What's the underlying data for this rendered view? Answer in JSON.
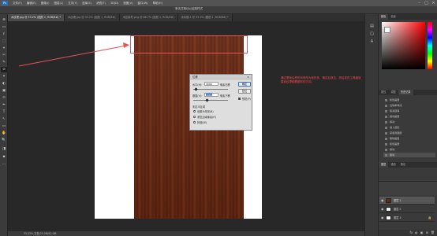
{
  "menubar": {
    "logo": "Ps",
    "items": [
      "文件(F)",
      "编辑(E)",
      "图像(I)",
      "图层(L)",
      "文字(Y)",
      "选择(S)",
      "滤镜(T)",
      "3D(D)",
      "视图(V)",
      "窗口(W)",
      "帮助(H)"
    ],
    "window_controls": [
      "–",
      "□",
      "×"
    ]
  },
  "optbar": {
    "title": "单击并拖动以绘制样式"
  },
  "tabs": [
    {
      "label": "木纹理.jpg @ 33.2% (图层 1, RGB/8#) *",
      "active": true
    },
    {
      "label": "木纹理.jpg @ 33.2% (图层 1, RGB/8#)"
    },
    {
      "label": "木纹素材.png @ 66.7% (图层 1, RGB/8#)"
    },
    {
      "label": "未标题-1 @ 33.3% (图层 1, RGB/8#) *"
    }
  ],
  "tools": [
    "⊕",
    "▭",
    "ℓ",
    "⬚",
    "⌖",
    "✄",
    "✎",
    "⊘",
    "✦",
    "◐",
    "▣",
    "⊙",
    "✒",
    "T",
    "↖",
    "▭",
    "✋",
    "🔍",
    "◨",
    "▪",
    "⋯"
  ],
  "annotation": "通过蒙版后把形状修改为矩形状，确定后双击，然后变形工具缩放直到纹理顺着图形的方向。",
  "dialog": {
    "title": "位移",
    "close": "×",
    "h_label": "水平(H):",
    "h_value": "4096",
    "h_unit": "像素右移",
    "v_label": "垂直(V):",
    "v_value": "3969",
    "v_unit": "像素下移",
    "undefined_label": "未定义区域",
    "opt1": "设置为背景(B)",
    "opt2": "重复边缘像素(R)",
    "opt3": "折回(W)",
    "ok": "确定",
    "cancel": "复位",
    "preview": "预览(P)"
  },
  "status": {
    "text": "33.33%   文档:21.0M/42.0M"
  },
  "panels": {
    "color_tabs": [
      "颜色",
      "色板"
    ],
    "history_tabs": [
      "属性",
      "调整",
      "历史记录"
    ],
    "history_items": [
      "新建画层",
      "清除参考线",
      "取消选择",
      "拖动画层",
      "移动",
      "载入选区",
      "蒙版到图层",
      "删除画层",
      "新建画层",
      "移动",
      "删除"
    ],
    "layer_tabs": [
      "图层",
      "通道",
      "路径"
    ],
    "layers": [
      {
        "name": "图层 1",
        "thumb": "#6a2a12"
      },
      {
        "name": "图层 2",
        "thumb": "#eeeeee"
      },
      {
        "name": "图层 3",
        "thumb": "#ffffff"
      }
    ],
    "bottom_icons": [
      "fx",
      "◐",
      "▣",
      "⊞",
      "🗑"
    ]
  },
  "colors": {
    "accent_red": "#e05555",
    "wood_dark": "#5b2210",
    "primary_button_border": "#2e6fd6"
  }
}
